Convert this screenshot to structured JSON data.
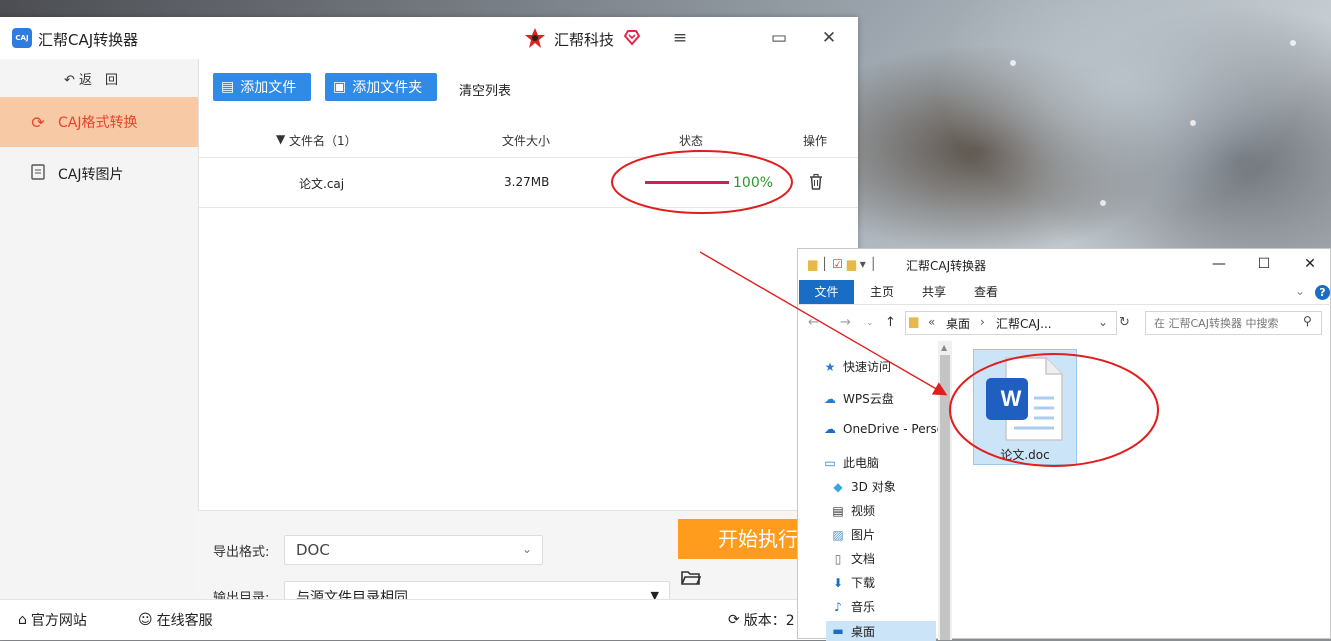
{
  "app": {
    "logo_text": "CAJ",
    "title": "汇帮CAJ转换器",
    "brand": "汇帮科技",
    "window_buttons": {
      "menu": "≡",
      "maximize": "▭",
      "close": "✕"
    }
  },
  "sidebar": {
    "back_label": "返　回",
    "items": [
      {
        "label": "CAJ格式转换",
        "icon": "refresh-icon",
        "active": true
      },
      {
        "label": "CAJ转图片",
        "icon": "document-icon",
        "active": false
      }
    ]
  },
  "toolbar": {
    "add_file": "添加文件",
    "add_folder": "添加文件夹",
    "clear_list": "清空列表"
  },
  "table": {
    "columns": {
      "name": "文件名（1）",
      "size": "文件大小",
      "status": "状态",
      "action": "操作"
    },
    "rows": [
      {
        "name": "论文.caj",
        "size": "3.27MB",
        "progress": 100,
        "progress_label": "100%"
      }
    ]
  },
  "bottom": {
    "format_label": "导出格式:",
    "format_value": "DOC",
    "dir_label": "输出目录:",
    "dir_value": "与源文件目录相同",
    "start_button": "开始执行"
  },
  "statusbar": {
    "website": "官方网站",
    "support": "在线客服",
    "version_label": "版本：2"
  },
  "explorer": {
    "title": "汇帮CAJ转换器",
    "ribbon_tabs": [
      "文件",
      "主页",
      "共享",
      "查看"
    ],
    "address": {
      "chevrons": "«",
      "crumb1": "桌面",
      "separator": "›",
      "crumb2": "汇帮CAJ..."
    },
    "search_placeholder": "在 汇帮CAJ转换器 中搜索",
    "nav_items": [
      {
        "label": "快速访问",
        "icon": "star-icon"
      },
      {
        "label": "WPS云盘",
        "icon": "cloud-icon"
      },
      {
        "label": "OneDrive - Perso",
        "icon": "onedrive-icon"
      },
      {
        "label": "此电脑",
        "icon": "computer-icon"
      },
      {
        "label": "3D 对象",
        "icon": "cube-icon"
      },
      {
        "label": "视频",
        "icon": "video-icon"
      },
      {
        "label": "图片",
        "icon": "picture-icon"
      },
      {
        "label": "文档",
        "icon": "document-icon"
      },
      {
        "label": "下载",
        "icon": "download-icon"
      },
      {
        "label": "音乐",
        "icon": "music-icon"
      },
      {
        "label": "桌面",
        "icon": "desktop-icon"
      }
    ],
    "file": {
      "name": "论文.doc",
      "icon_letter": "W"
    }
  },
  "colors": {
    "accent_blue": "#2f8be6",
    "active_sidebar_bg": "#f7c9a4",
    "active_sidebar_text": "#e8432d",
    "start_button": "#ff9c1e",
    "progress_fill": "#d21f57",
    "progress_text": "#2a9a2a",
    "annotation_red": "#e11d1d"
  }
}
